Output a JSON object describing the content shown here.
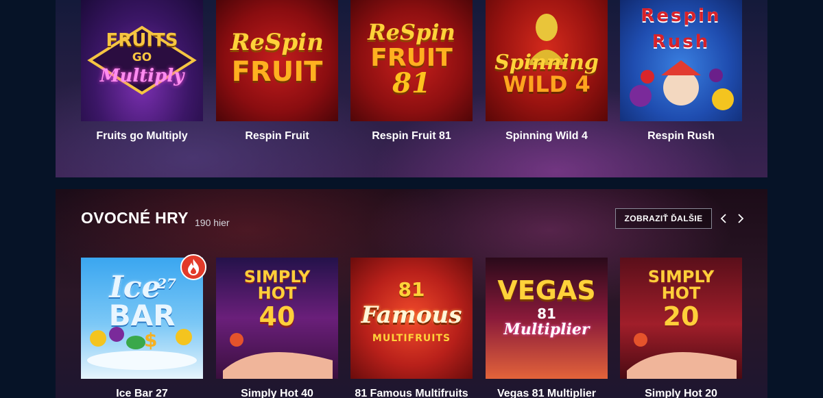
{
  "top_section": {
    "games": [
      {
        "title": "Fruits go Multiply",
        "logo_lines": [
          "FRUITS",
          "GO",
          "Multiply"
        ]
      },
      {
        "title": "Respin Fruit",
        "logo_lines": [
          "ReSpin",
          "FRUIT"
        ]
      },
      {
        "title": "Respin Fruit 81",
        "logo_lines": [
          "ReSpin",
          "FRUIT",
          "81"
        ]
      },
      {
        "title": "Spinning Wild 4",
        "logo_lines": [
          "Spinning",
          "WILD 4"
        ]
      },
      {
        "title": "Respin Rush",
        "logo_lines": [
          "Respin",
          "Rush"
        ]
      }
    ]
  },
  "fruit_section": {
    "title": "OVOCNÉ HRY",
    "count": "190 hier",
    "more_label": "ZOBRAZIŤ ĎALŠIE",
    "games": [
      {
        "title": "Ice Bar 27",
        "logo_lines": [
          "Ice",
          "27",
          "BAR"
        ],
        "hot": true
      },
      {
        "title": "Simply Hot 40",
        "logo_lines": [
          "SIMPLY",
          "HOT",
          "40"
        ]
      },
      {
        "title": "81 Famous Multifruits",
        "logo_lines": [
          "81",
          "Famous",
          "MULTIFRUITS"
        ]
      },
      {
        "title": "Vegas 81 Multiplier",
        "logo_lines": [
          "VEGAS",
          "81",
          "Multiplier"
        ]
      },
      {
        "title": "Simply Hot 20",
        "logo_lines": [
          "SIMPLY",
          "HOT",
          "20"
        ]
      }
    ]
  },
  "colors": {
    "page_bg": "#061327",
    "accent_gold": "#f6b021",
    "hot_badge": "#e23a2a"
  },
  "icons": [
    "flame-icon",
    "chevron-left-icon",
    "chevron-right-icon"
  ]
}
